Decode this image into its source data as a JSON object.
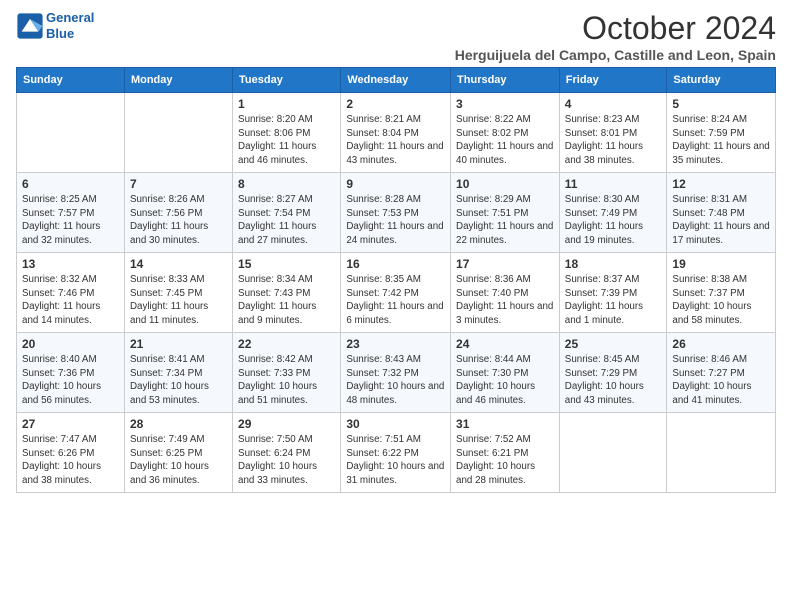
{
  "header": {
    "logo_line1": "General",
    "logo_line2": "Blue",
    "month_title": "October 2024",
    "location": "Herguijuela del Campo, Castille and Leon, Spain"
  },
  "calendar": {
    "days_of_week": [
      "Sunday",
      "Monday",
      "Tuesday",
      "Wednesday",
      "Thursday",
      "Friday",
      "Saturday"
    ],
    "weeks": [
      [
        {
          "day": "",
          "info": ""
        },
        {
          "day": "",
          "info": ""
        },
        {
          "day": "1",
          "info": "Sunrise: 8:20 AM\nSunset: 8:06 PM\nDaylight: 11 hours and 46 minutes."
        },
        {
          "day": "2",
          "info": "Sunrise: 8:21 AM\nSunset: 8:04 PM\nDaylight: 11 hours and 43 minutes."
        },
        {
          "day": "3",
          "info": "Sunrise: 8:22 AM\nSunset: 8:02 PM\nDaylight: 11 hours and 40 minutes."
        },
        {
          "day": "4",
          "info": "Sunrise: 8:23 AM\nSunset: 8:01 PM\nDaylight: 11 hours and 38 minutes."
        },
        {
          "day": "5",
          "info": "Sunrise: 8:24 AM\nSunset: 7:59 PM\nDaylight: 11 hours and 35 minutes."
        }
      ],
      [
        {
          "day": "6",
          "info": "Sunrise: 8:25 AM\nSunset: 7:57 PM\nDaylight: 11 hours and 32 minutes."
        },
        {
          "day": "7",
          "info": "Sunrise: 8:26 AM\nSunset: 7:56 PM\nDaylight: 11 hours and 30 minutes."
        },
        {
          "day": "8",
          "info": "Sunrise: 8:27 AM\nSunset: 7:54 PM\nDaylight: 11 hours and 27 minutes."
        },
        {
          "day": "9",
          "info": "Sunrise: 8:28 AM\nSunset: 7:53 PM\nDaylight: 11 hours and 24 minutes."
        },
        {
          "day": "10",
          "info": "Sunrise: 8:29 AM\nSunset: 7:51 PM\nDaylight: 11 hours and 22 minutes."
        },
        {
          "day": "11",
          "info": "Sunrise: 8:30 AM\nSunset: 7:49 PM\nDaylight: 11 hours and 19 minutes."
        },
        {
          "day": "12",
          "info": "Sunrise: 8:31 AM\nSunset: 7:48 PM\nDaylight: 11 hours and 17 minutes."
        }
      ],
      [
        {
          "day": "13",
          "info": "Sunrise: 8:32 AM\nSunset: 7:46 PM\nDaylight: 11 hours and 14 minutes."
        },
        {
          "day": "14",
          "info": "Sunrise: 8:33 AM\nSunset: 7:45 PM\nDaylight: 11 hours and 11 minutes."
        },
        {
          "day": "15",
          "info": "Sunrise: 8:34 AM\nSunset: 7:43 PM\nDaylight: 11 hours and 9 minutes."
        },
        {
          "day": "16",
          "info": "Sunrise: 8:35 AM\nSunset: 7:42 PM\nDaylight: 11 hours and 6 minutes."
        },
        {
          "day": "17",
          "info": "Sunrise: 8:36 AM\nSunset: 7:40 PM\nDaylight: 11 hours and 3 minutes."
        },
        {
          "day": "18",
          "info": "Sunrise: 8:37 AM\nSunset: 7:39 PM\nDaylight: 11 hours and 1 minute."
        },
        {
          "day": "19",
          "info": "Sunrise: 8:38 AM\nSunset: 7:37 PM\nDaylight: 10 hours and 58 minutes."
        }
      ],
      [
        {
          "day": "20",
          "info": "Sunrise: 8:40 AM\nSunset: 7:36 PM\nDaylight: 10 hours and 56 minutes."
        },
        {
          "day": "21",
          "info": "Sunrise: 8:41 AM\nSunset: 7:34 PM\nDaylight: 10 hours and 53 minutes."
        },
        {
          "day": "22",
          "info": "Sunrise: 8:42 AM\nSunset: 7:33 PM\nDaylight: 10 hours and 51 minutes."
        },
        {
          "day": "23",
          "info": "Sunrise: 8:43 AM\nSunset: 7:32 PM\nDaylight: 10 hours and 48 minutes."
        },
        {
          "day": "24",
          "info": "Sunrise: 8:44 AM\nSunset: 7:30 PM\nDaylight: 10 hours and 46 minutes."
        },
        {
          "day": "25",
          "info": "Sunrise: 8:45 AM\nSunset: 7:29 PM\nDaylight: 10 hours and 43 minutes."
        },
        {
          "day": "26",
          "info": "Sunrise: 8:46 AM\nSunset: 7:27 PM\nDaylight: 10 hours and 41 minutes."
        }
      ],
      [
        {
          "day": "27",
          "info": "Sunrise: 7:47 AM\nSunset: 6:26 PM\nDaylight: 10 hours and 38 minutes."
        },
        {
          "day": "28",
          "info": "Sunrise: 7:49 AM\nSunset: 6:25 PM\nDaylight: 10 hours and 36 minutes."
        },
        {
          "day": "29",
          "info": "Sunrise: 7:50 AM\nSunset: 6:24 PM\nDaylight: 10 hours and 33 minutes."
        },
        {
          "day": "30",
          "info": "Sunrise: 7:51 AM\nSunset: 6:22 PM\nDaylight: 10 hours and 31 minutes."
        },
        {
          "day": "31",
          "info": "Sunrise: 7:52 AM\nSunset: 6:21 PM\nDaylight: 10 hours and 28 minutes."
        },
        {
          "day": "",
          "info": ""
        },
        {
          "day": "",
          "info": ""
        }
      ]
    ]
  }
}
